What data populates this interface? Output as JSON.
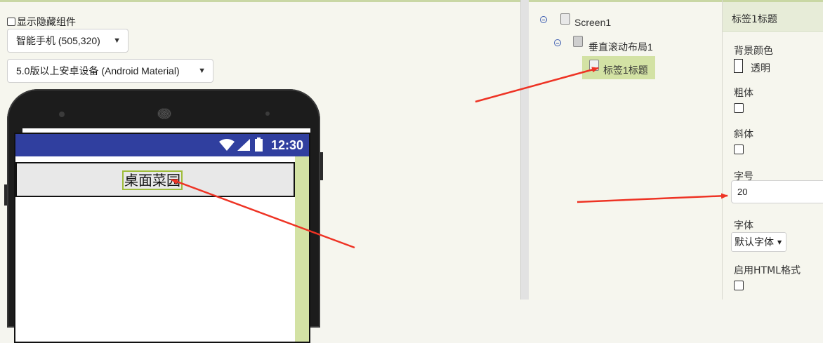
{
  "viewer": {
    "show_hidden_label": "显示隐藏组件",
    "device_select": "智能手机 (505,320)",
    "theme_select": "5.0版以上安卓设备 (Android Material)",
    "status_time": "12:30",
    "label_text": "桌面菜园"
  },
  "tree": {
    "nodes": [
      {
        "label": "Screen1"
      },
      {
        "label": "垂直滚动布局1"
      },
      {
        "label": "标签1标题"
      }
    ]
  },
  "properties": {
    "title": "标签1标题",
    "background_color_label": "背景颜色",
    "background_color_value": "透明",
    "bold_label": "粗体",
    "italic_label": "斜体",
    "font_size_label": "字号",
    "font_size_value": "20",
    "font_label": "字体",
    "font_value": "默认字体",
    "html_label": "启用HTML格式"
  },
  "colors": {
    "status_bar": "#303f9f",
    "accent_green": "#d3e2a4",
    "arrow_red": "#ee3324"
  }
}
